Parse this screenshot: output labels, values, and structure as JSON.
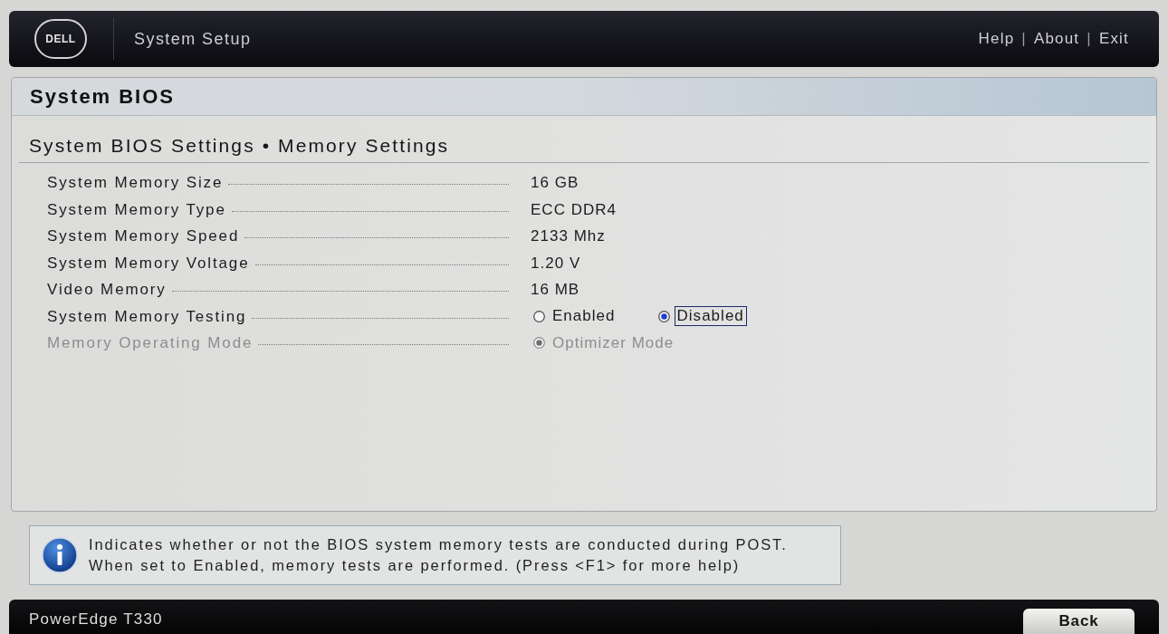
{
  "header": {
    "logo": "DELL",
    "title": "System Setup",
    "menu": [
      {
        "kind": "link",
        "label": "Help"
      },
      {
        "kind": "separator",
        "label": "|"
      },
      {
        "kind": "link",
        "label": "About"
      },
      {
        "kind": "separator",
        "label": "|"
      },
      {
        "kind": "link",
        "label": "Exit"
      }
    ]
  },
  "panel": {
    "title": "System BIOS",
    "breadcrumb": "System BIOS Settings • Memory Settings",
    "settings": [
      {
        "kind": "value",
        "label": "System Memory Size",
        "value": "16 GB",
        "disabled": false
      },
      {
        "kind": "value",
        "label": "System Memory Type",
        "value": "ECC DDR4",
        "disabled": false
      },
      {
        "kind": "value",
        "label": "System Memory Speed",
        "value": "2133 Mhz",
        "disabled": false
      },
      {
        "kind": "value",
        "label": "System Memory Voltage",
        "value": "1.20 V",
        "disabled": false
      },
      {
        "kind": "value",
        "label": "Video Memory",
        "value": "16 MB",
        "disabled": false
      },
      {
        "kind": "radio",
        "label": "System Memory Testing",
        "disabled": false,
        "options": [
          {
            "label": "Enabled",
            "selected": false,
            "focused": false
          },
          {
            "label": "Disabled",
            "selected": true,
            "focused": true
          }
        ]
      },
      {
        "kind": "radio",
        "label": "Memory Operating Mode",
        "disabled": true,
        "options": [
          {
            "label": "Optimizer Mode",
            "selected": true,
            "focused": false
          }
        ]
      }
    ]
  },
  "help": {
    "lines": [
      "Indicates whether or not the BIOS system memory tests are conducted during POST.",
      "When set to Enabled, memory tests are performed. (Press <F1> for more help)"
    ]
  },
  "footer": {
    "model": "PowerEdge T330",
    "button": "Back"
  }
}
